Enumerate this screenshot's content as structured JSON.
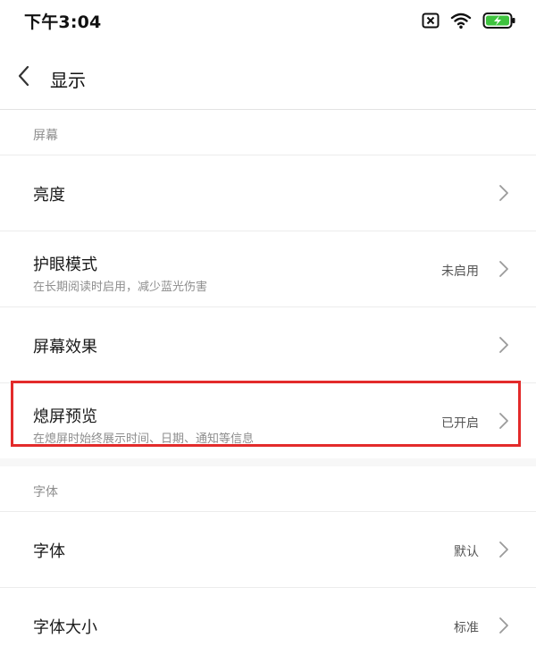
{
  "status_bar": {
    "time": "下午3:04",
    "icons": [
      "no-sim-icon",
      "wifi-icon",
      "battery-charging-icon"
    ]
  },
  "header": {
    "back_icon": "chevron-left-icon",
    "title": "显示"
  },
  "sections": [
    {
      "label": "屏幕",
      "rows": [
        {
          "title": "亮度",
          "subtitle": "",
          "value": ""
        },
        {
          "title": "护眼模式",
          "subtitle": "在长期阅读时启用，减少蓝光伤害",
          "value": "未启用"
        },
        {
          "title": "屏幕效果",
          "subtitle": "",
          "value": ""
        },
        {
          "title": "熄屏预览",
          "subtitle": "在熄屏时始终展示时间、日期、通知等信息",
          "value": "已开启"
        }
      ]
    },
    {
      "label": "字体",
      "rows": [
        {
          "title": "字体",
          "subtitle": "",
          "value": "默认"
        },
        {
          "title": "字体大小",
          "subtitle": "",
          "value": "标准"
        }
      ]
    }
  ],
  "colors": {
    "highlight": "#e32b2b",
    "background": "#f7f7f7",
    "battery_fill": "#3fc33f"
  }
}
